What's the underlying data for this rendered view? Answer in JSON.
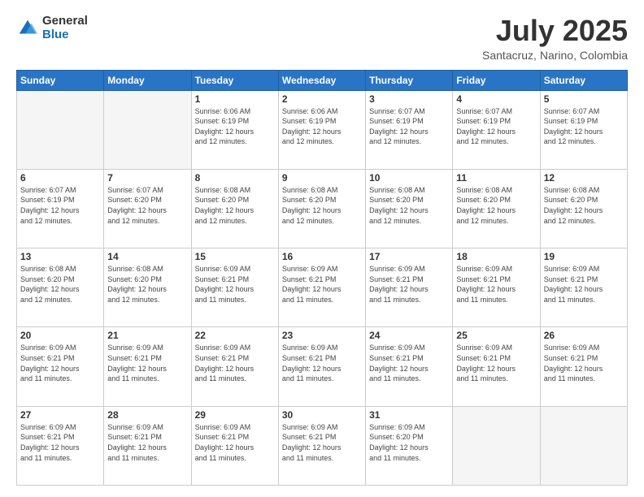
{
  "header": {
    "logo_general": "General",
    "logo_blue": "Blue",
    "month_year": "July 2025",
    "location": "Santacruz, Narino, Colombia"
  },
  "weekdays": [
    "Sunday",
    "Monday",
    "Tuesday",
    "Wednesday",
    "Thursday",
    "Friday",
    "Saturday"
  ],
  "weeks": [
    [
      {
        "day": "",
        "info": ""
      },
      {
        "day": "",
        "info": ""
      },
      {
        "day": "1",
        "info": "Sunrise: 6:06 AM\nSunset: 6:19 PM\nDaylight: 12 hours\nand 12 minutes."
      },
      {
        "day": "2",
        "info": "Sunrise: 6:06 AM\nSunset: 6:19 PM\nDaylight: 12 hours\nand 12 minutes."
      },
      {
        "day": "3",
        "info": "Sunrise: 6:07 AM\nSunset: 6:19 PM\nDaylight: 12 hours\nand 12 minutes."
      },
      {
        "day": "4",
        "info": "Sunrise: 6:07 AM\nSunset: 6:19 PM\nDaylight: 12 hours\nand 12 minutes."
      },
      {
        "day": "5",
        "info": "Sunrise: 6:07 AM\nSunset: 6:19 PM\nDaylight: 12 hours\nand 12 minutes."
      }
    ],
    [
      {
        "day": "6",
        "info": "Sunrise: 6:07 AM\nSunset: 6:19 PM\nDaylight: 12 hours\nand 12 minutes."
      },
      {
        "day": "7",
        "info": "Sunrise: 6:07 AM\nSunset: 6:20 PM\nDaylight: 12 hours\nand 12 minutes."
      },
      {
        "day": "8",
        "info": "Sunrise: 6:08 AM\nSunset: 6:20 PM\nDaylight: 12 hours\nand 12 minutes."
      },
      {
        "day": "9",
        "info": "Sunrise: 6:08 AM\nSunset: 6:20 PM\nDaylight: 12 hours\nand 12 minutes."
      },
      {
        "day": "10",
        "info": "Sunrise: 6:08 AM\nSunset: 6:20 PM\nDaylight: 12 hours\nand 12 minutes."
      },
      {
        "day": "11",
        "info": "Sunrise: 6:08 AM\nSunset: 6:20 PM\nDaylight: 12 hours\nand 12 minutes."
      },
      {
        "day": "12",
        "info": "Sunrise: 6:08 AM\nSunset: 6:20 PM\nDaylight: 12 hours\nand 12 minutes."
      }
    ],
    [
      {
        "day": "13",
        "info": "Sunrise: 6:08 AM\nSunset: 6:20 PM\nDaylight: 12 hours\nand 12 minutes."
      },
      {
        "day": "14",
        "info": "Sunrise: 6:08 AM\nSunset: 6:20 PM\nDaylight: 12 hours\nand 12 minutes."
      },
      {
        "day": "15",
        "info": "Sunrise: 6:09 AM\nSunset: 6:21 PM\nDaylight: 12 hours\nand 11 minutes."
      },
      {
        "day": "16",
        "info": "Sunrise: 6:09 AM\nSunset: 6:21 PM\nDaylight: 12 hours\nand 11 minutes."
      },
      {
        "day": "17",
        "info": "Sunrise: 6:09 AM\nSunset: 6:21 PM\nDaylight: 12 hours\nand 11 minutes."
      },
      {
        "day": "18",
        "info": "Sunrise: 6:09 AM\nSunset: 6:21 PM\nDaylight: 12 hours\nand 11 minutes."
      },
      {
        "day": "19",
        "info": "Sunrise: 6:09 AM\nSunset: 6:21 PM\nDaylight: 12 hours\nand 11 minutes."
      }
    ],
    [
      {
        "day": "20",
        "info": "Sunrise: 6:09 AM\nSunset: 6:21 PM\nDaylight: 12 hours\nand 11 minutes."
      },
      {
        "day": "21",
        "info": "Sunrise: 6:09 AM\nSunset: 6:21 PM\nDaylight: 12 hours\nand 11 minutes."
      },
      {
        "day": "22",
        "info": "Sunrise: 6:09 AM\nSunset: 6:21 PM\nDaylight: 12 hours\nand 11 minutes."
      },
      {
        "day": "23",
        "info": "Sunrise: 6:09 AM\nSunset: 6:21 PM\nDaylight: 12 hours\nand 11 minutes."
      },
      {
        "day": "24",
        "info": "Sunrise: 6:09 AM\nSunset: 6:21 PM\nDaylight: 12 hours\nand 11 minutes."
      },
      {
        "day": "25",
        "info": "Sunrise: 6:09 AM\nSunset: 6:21 PM\nDaylight: 12 hours\nand 11 minutes."
      },
      {
        "day": "26",
        "info": "Sunrise: 6:09 AM\nSunset: 6:21 PM\nDaylight: 12 hours\nand 11 minutes."
      }
    ],
    [
      {
        "day": "27",
        "info": "Sunrise: 6:09 AM\nSunset: 6:21 PM\nDaylight: 12 hours\nand 11 minutes."
      },
      {
        "day": "28",
        "info": "Sunrise: 6:09 AM\nSunset: 6:21 PM\nDaylight: 12 hours\nand 11 minutes."
      },
      {
        "day": "29",
        "info": "Sunrise: 6:09 AM\nSunset: 6:21 PM\nDaylight: 12 hours\nand 11 minutes."
      },
      {
        "day": "30",
        "info": "Sunrise: 6:09 AM\nSunset: 6:21 PM\nDaylight: 12 hours\nand 11 minutes."
      },
      {
        "day": "31",
        "info": "Sunrise: 6:09 AM\nSunset: 6:20 PM\nDaylight: 12 hours\nand 11 minutes."
      },
      {
        "day": "",
        "info": ""
      },
      {
        "day": "",
        "info": ""
      }
    ]
  ]
}
